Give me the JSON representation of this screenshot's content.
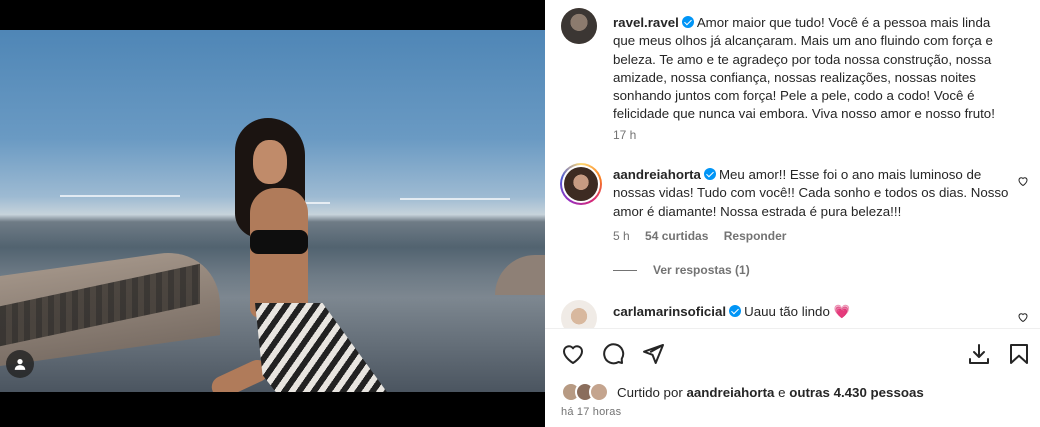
{
  "post": {
    "author": "ravel.ravel",
    "caption": "Amor maior que tudo! Você é a pessoa mais linda que meus olhos já alcançaram. Mais um ano fluindo com força e beleza. Te amo e te agradeço por toda nossa construção, nossa amizade, nossa confiança, nossas realizações, nossas noites sonhando juntos com força! Pele a pele, codo a codo! Você é felicidade que nunca vai embora. Viva nosso amor e nosso fruto!",
    "caption_time": "17 h"
  },
  "comments": [
    {
      "username": "aandreiahorta",
      "text": "Meu amor!! Esse foi o ano mais luminoso de nossas vidas! Tudo com você!! Cada sonho e todos os dias. Nosso amor é diamante! Nossa estrada é pura beleza!!!",
      "time": "5 h",
      "likes": "54 curtidas",
      "reply_label": "Responder",
      "view_replies": "Ver respostas (1)"
    },
    {
      "username": "carlamarinsoficial",
      "text": "Uauu tão lindo 💗"
    }
  ],
  "likes_summary": {
    "prefix": "Curtido por",
    "user": "aandreiahorta",
    "conjunction": "e",
    "others": "outras 4.430 pessoas"
  },
  "post_time": "há 17 horas",
  "colors": {
    "verified": "#0095f6",
    "secondary_text": "#737373"
  },
  "icons": [
    "user-tag-icon",
    "heart-icon",
    "comment-icon",
    "share-icon",
    "save-icon",
    "download-icon",
    "verified-icon"
  ]
}
